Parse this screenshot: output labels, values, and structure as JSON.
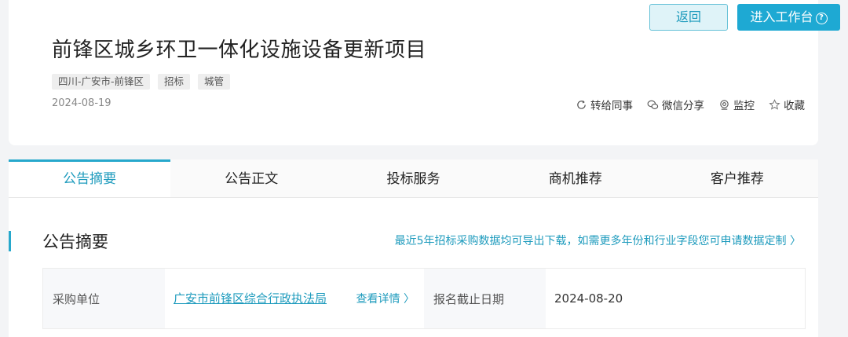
{
  "header": {
    "back_label": "返回",
    "workbench_label": "进入工作台",
    "title": "前锋区城乡环卫一体化设施设备更新项目",
    "tags": [
      "四川-广安市-前锋区",
      "招标",
      "城管"
    ],
    "date": "2024-08-19",
    "actions": {
      "forward": "转给同事",
      "wechat_share": "微信分享",
      "monitor": "监控",
      "favorite": "收藏"
    }
  },
  "tabs": [
    {
      "label": "公告摘要"
    },
    {
      "label": "公告正文"
    },
    {
      "label": "投标服务"
    },
    {
      "label": "商机推荐"
    },
    {
      "label": "客户推荐"
    }
  ],
  "summary": {
    "title": "公告摘要",
    "export_link": "最近5年招标采购数据均可导出下载，如需更多年份和行业字段您可申请数据定制 〉",
    "purchaser_label": "采购单位",
    "purchaser_value": "广安市前锋区综合行政执法局",
    "detail_link": "查看详情 〉",
    "deadline_label": "报名截止日期",
    "deadline_value": "2024-08-20"
  },
  "colors": {
    "accent": "#1e9bbd",
    "primary_button": "#1ea9d3",
    "page_bg": "#f3f4f6"
  }
}
